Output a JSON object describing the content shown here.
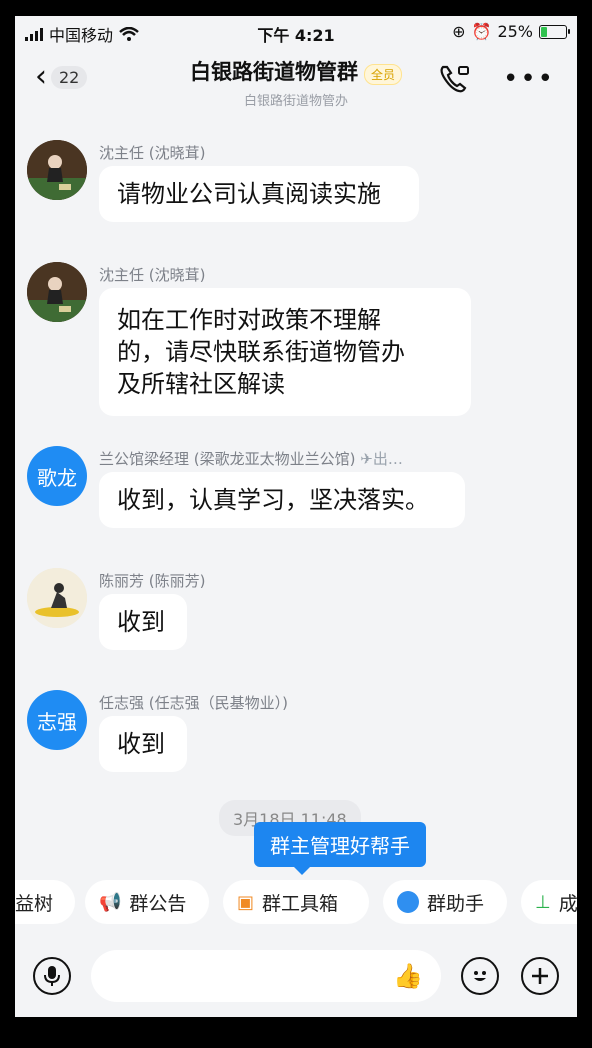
{
  "status_bar": {
    "carrier": "中国移动",
    "time": "下午 4:21",
    "battery": "25%"
  },
  "header": {
    "back_count": "22",
    "title": "白银路街道物管群",
    "badge": "全员",
    "subtitle": "白银路街道物管办"
  },
  "messages": [
    {
      "sender": "沈主任 (沈晓茸)",
      "text": "请物业公司认真阅读实施"
    },
    {
      "sender": "沈主任 (沈晓茸)",
      "text_lines": [
        "如在工作时对政策不理解",
        "的，请尽快联系街道物管办",
        "及所辖社区解读"
      ]
    },
    {
      "sender": "兰公馆梁经理 (梁歌龙亚太物业兰公馆)",
      "sender_extra": "✈出…",
      "avatar_text": "歌龙",
      "text": "收到，认真学习，坚决落实。"
    },
    {
      "sender": "陈丽芳 (陈丽芳)",
      "text": "收到"
    },
    {
      "sender": "任志强 (任志强（民基物业）)",
      "avatar_text": "志强",
      "text": "收到"
    }
  ],
  "time_divider": "3月18日 11:48",
  "tooltip": "群主管理好帮手",
  "toolbar": {
    "chip0": "益树",
    "chip1": "群公告",
    "chip2": "群工具箱",
    "chip3": "群助手",
    "chip4": "成"
  },
  "colors": {
    "accent": "#1d86f0",
    "background": "#f3f4f6",
    "bubble": "#ffffff"
  }
}
